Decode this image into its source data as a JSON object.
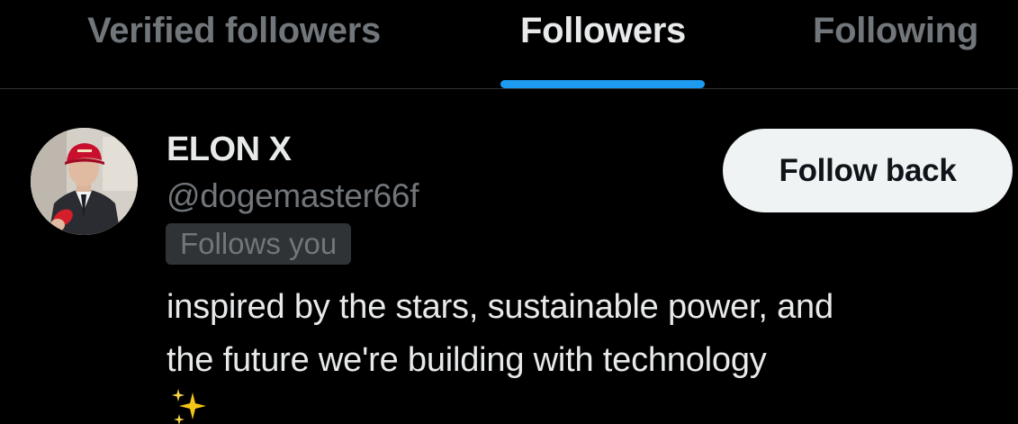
{
  "tabs": [
    {
      "label": "Verified followers",
      "active": false
    },
    {
      "label": "Followers",
      "active": true
    },
    {
      "label": "Following",
      "active": false
    }
  ],
  "user": {
    "display_name": "ELON X",
    "handle": "@dogemaster66f",
    "follows_you_badge": "Follows you",
    "bio_lines": [
      "inspired by the stars, sustainable power, and",
      "the future we're building with technology"
    ],
    "bio_emoji_icon": "sparkles-icon",
    "avatar_icon": "user-avatar-photo",
    "follow_back_label": "Follow back"
  },
  "colors": {
    "background": "#000000",
    "text_primary": "#e7e9ea",
    "text_secondary": "#71767b",
    "accent": "#1d9bf0",
    "divider": "#2f3336",
    "button_bg": "#eff3f4",
    "button_text": "#0f1419"
  }
}
